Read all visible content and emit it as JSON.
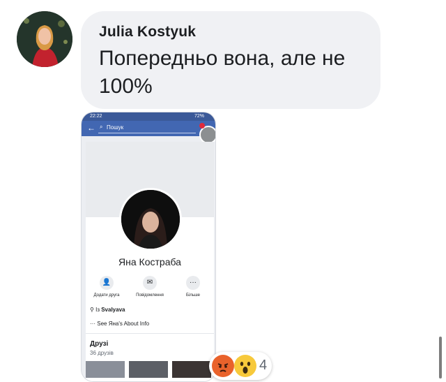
{
  "comment": {
    "author": "Julia Kostyuk",
    "text": "Попередньо вона, але не 100%"
  },
  "attachment": {
    "status_time": "22:22",
    "status_battery": "72%",
    "search_placeholder": "Пошук",
    "profile_name": "Яна Костраба",
    "actions": [
      {
        "label": "Додати друга",
        "icon": "add-friend-icon"
      },
      {
        "label": "Повідомлення",
        "icon": "messenger-icon"
      },
      {
        "label": "Більше",
        "icon": "more-icon"
      }
    ],
    "location_prefix": "Із",
    "location_value": "Svalyava",
    "about_text": "See Яна's About Info",
    "friends_heading": "Друзі",
    "friends_count": "36 друзів"
  },
  "reactions": {
    "count": "4",
    "types": [
      "angry",
      "wow"
    ]
  },
  "colors": {
    "bubble_bg": "#f0f1f4",
    "fb_blue": "#4267b2",
    "angry": "#e9622b",
    "wow": "#f7c93b"
  }
}
